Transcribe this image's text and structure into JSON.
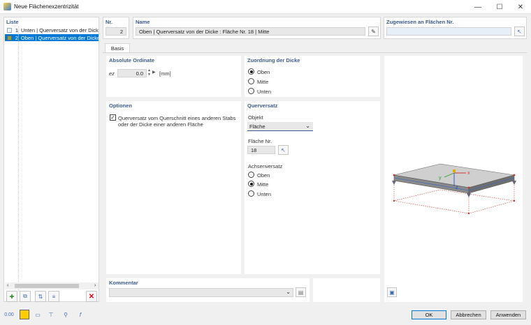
{
  "window": {
    "title": "Neue Flächenexzentrizität",
    "minimize": "—",
    "maximize": "☐",
    "close": "✕"
  },
  "list": {
    "header": "Liste",
    "items": [
      {
        "num": "1",
        "text": "Unten | Querversatz von der Dicke",
        "color": "#e6f7ff"
      },
      {
        "num": "2",
        "text": "Oben | Querversatz von der Dicke :",
        "color": "#8fa33b"
      }
    ]
  },
  "header": {
    "nr_label": "Nr.",
    "nr_value": "2",
    "name_label": "Name",
    "name_value": "Oben | Querversatz von der Dicke : Fläche Nr. 18 | Mitte",
    "assigned_label": "Zugewiesen an Flächen Nr.",
    "assigned_value": ""
  },
  "tabs": [
    {
      "label": "Basis"
    }
  ],
  "ordinate": {
    "title": "Absolute Ordinate",
    "symbol": "ez",
    "value": "0.0",
    "unit": "[mm]"
  },
  "thickness": {
    "title": "Zuordnung der Dicke",
    "options": [
      "Oben",
      "Mitte",
      "Unten"
    ],
    "selected": 0
  },
  "options": {
    "title": "Optionen",
    "checkbox_line1": "Querversatz vom Querschnitt eines anderen Stabs",
    "checkbox_line2": "oder der Dicke einer anderen Fläche",
    "checked": true
  },
  "offset": {
    "title": "Querversatz",
    "object_label": "Objekt",
    "object_value": "Fläche",
    "surface_label": "Fläche Nr.",
    "surface_value": "18",
    "axis_label": "Achsenversatz",
    "axis_options": [
      "Oben",
      "Mitte",
      "Unten"
    ],
    "axis_selected": 1
  },
  "comment": {
    "title": "Kommentar",
    "value": ""
  },
  "preview": {
    "axis_x": "x",
    "axis_y": "y",
    "axis_z": "z"
  },
  "buttons": {
    "ok": "OK",
    "cancel": "Abbrechen",
    "apply": "Anwenden"
  },
  "colors": {
    "accent": "#3d5a8c",
    "selection": "#0078d7",
    "delete": "#d8001c"
  }
}
